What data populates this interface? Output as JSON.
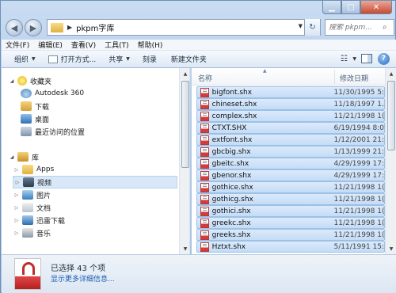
{
  "address": {
    "segments": [
      "pkpm字库"
    ]
  },
  "search": {
    "placeholder": "搜索 pkpm..."
  },
  "menu": [
    "文件(F)",
    "编辑(E)",
    "查看(V)",
    "工具(T)",
    "帮助(H)"
  ],
  "toolbar": {
    "organize": "组织",
    "open_with": "打开方式...",
    "share": "共享",
    "burn": "刻录",
    "new_folder": "新建文件夹"
  },
  "nav": {
    "favorites": {
      "label": "收藏夹",
      "items": [
        "Autodesk 360",
        "下载",
        "桌面",
        "最近访问的位置"
      ]
    },
    "libraries": {
      "label": "库",
      "items": [
        "Apps",
        "视频",
        "图片",
        "文档",
        "迅雷下载",
        "音乐"
      ]
    }
  },
  "columns": {
    "name": "名称",
    "date": "修改日期"
  },
  "files": [
    {
      "name": "bigfont.shx",
      "date": "11/30/1995 5:..."
    },
    {
      "name": "chineset.shx",
      "date": "11/18/1997 1..."
    },
    {
      "name": "complex.shx",
      "date": "11/21/1998 1(..."
    },
    {
      "name": "CTXT.SHX",
      "date": "6/19/1994 8:0..."
    },
    {
      "name": "extfont.shx",
      "date": "1/12/2001 21:..."
    },
    {
      "name": "gbcbig.shx",
      "date": "1/13/1999 21:..."
    },
    {
      "name": "gbeitc.shx",
      "date": "4/29/1999 17:..."
    },
    {
      "name": "gbenor.shx",
      "date": "4/29/1999 17:..."
    },
    {
      "name": "gothice.shx",
      "date": "11/21/1998 1(..."
    },
    {
      "name": "gothicg.shx",
      "date": "11/21/1998 1(..."
    },
    {
      "name": "gothici.shx",
      "date": "11/21/1998 1(..."
    },
    {
      "name": "greekc.shx",
      "date": "11/21/1998 1(..."
    },
    {
      "name": "greeks.shx",
      "date": "11/21/1998 1(..."
    },
    {
      "name": "Hztxt.shx",
      "date": "5/11/1991 15:..."
    }
  ],
  "details": {
    "selected_count": "已选择 43 个项",
    "more_details": "显示更多详细信息..."
  }
}
